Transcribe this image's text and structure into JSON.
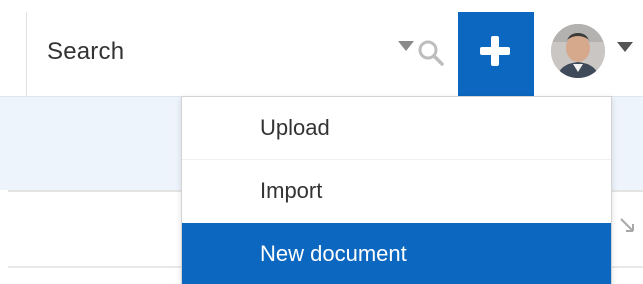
{
  "header": {
    "search_label": "Search",
    "search_icon": "magnifier",
    "add_icon": "plus",
    "avatar_icon": "user-photo"
  },
  "menu": {
    "items": [
      {
        "label": "Upload",
        "selected": false
      },
      {
        "label": "Import",
        "selected": false
      },
      {
        "label": "New document",
        "selected": true
      }
    ]
  },
  "colors": {
    "accent": "#0b67bf",
    "band": "#eef4fb",
    "text": "#333333"
  }
}
